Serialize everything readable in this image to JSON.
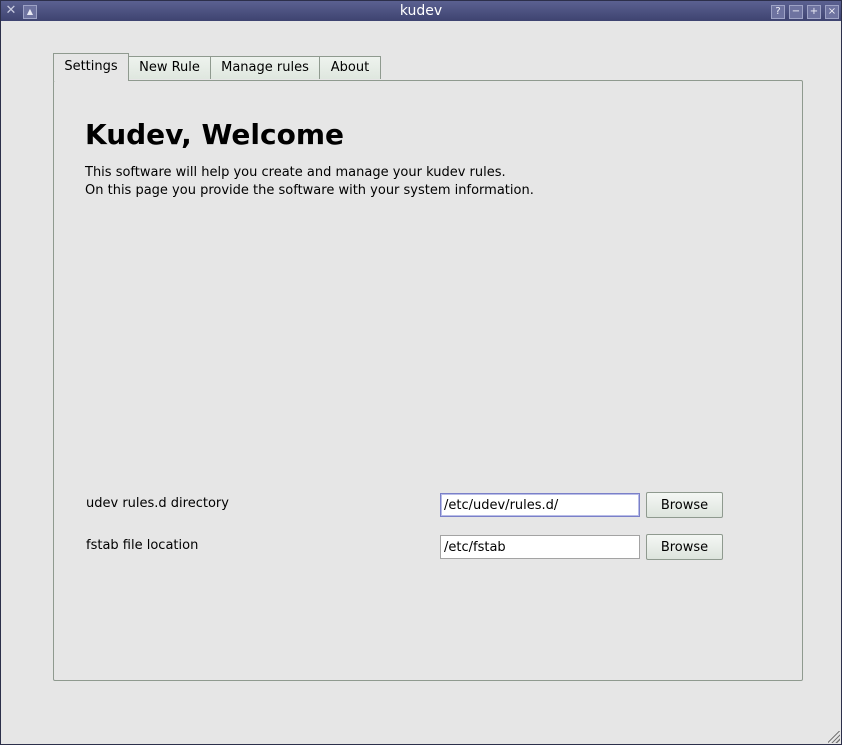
{
  "window": {
    "title": "kudev",
    "controls": {
      "help_label": "?",
      "minimize_label": "−",
      "maximize_label": "+",
      "close_label": "×"
    }
  },
  "tabs": [
    {
      "label": "Settings",
      "active": true
    },
    {
      "label": "New Rule",
      "active": false
    },
    {
      "label": "Manage rules",
      "active": false
    },
    {
      "label": "About",
      "active": false
    }
  ],
  "settings": {
    "heading": "Kudev, Welcome",
    "description_line1": "This software will help you create and manage your kudev rules.",
    "description_line2": "On this page you provide the software with your system information.",
    "rules_dir": {
      "label": "udev rules.d directory",
      "value": "/etc/udev/rules.d/",
      "button_label": "Browse"
    },
    "fstab": {
      "label": "fstab file location",
      "value": "/etc/fstab",
      "button_label": "Browse"
    }
  }
}
